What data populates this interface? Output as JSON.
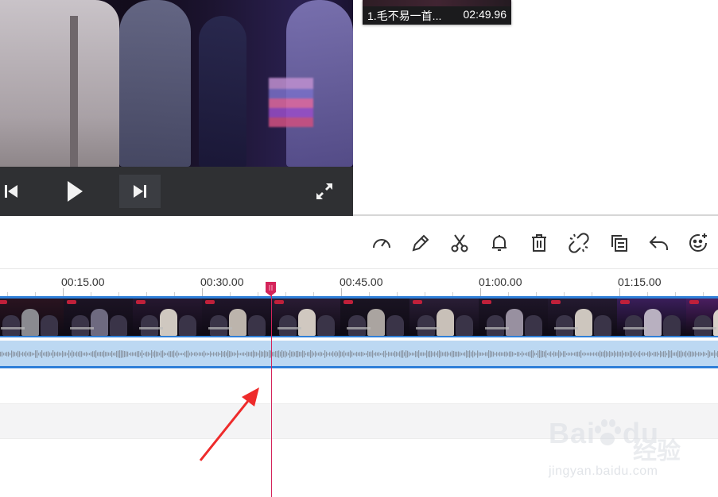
{
  "preview": {
    "controls": {
      "prev_icon": "skip-back-icon",
      "play_icon": "play-icon",
      "next_icon": "skip-forward-icon",
      "fullscreen_icon": "fullscreen-icon"
    }
  },
  "media_item": {
    "name": "1.毛不易一首...",
    "duration": "02:49.96"
  },
  "toolbar": {
    "icons": [
      "speed-icon",
      "edit-icon",
      "scissors-icon",
      "bell-icon",
      "trash-icon",
      "unlink-icon",
      "copy-icon",
      "undo-icon",
      "emoji-icon"
    ]
  },
  "timeline": {
    "ruler_labels": [
      "00:15.00",
      "00:30.00",
      "00:45.00",
      "01:00.00",
      "01:15.00"
    ],
    "playhead_color": "#d4245a",
    "track_accent": "#2f7fd8",
    "audio_fill": "#bcd8f2"
  },
  "watermark": {
    "brand": "Bai",
    "brand2": "du",
    "cn": "经验",
    "url": "jingyan.baidu.com"
  }
}
